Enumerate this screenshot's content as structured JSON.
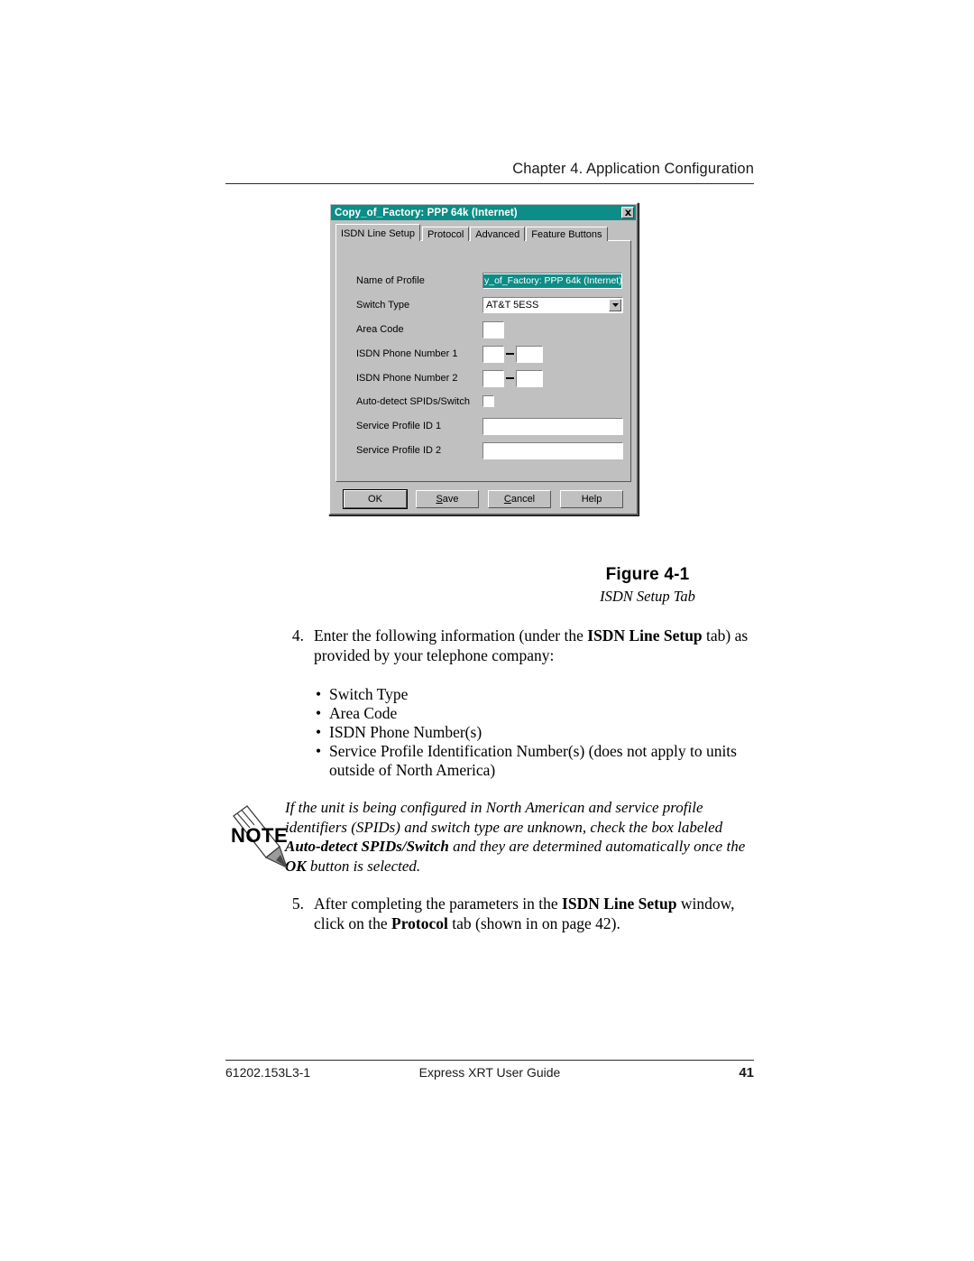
{
  "header": {
    "chapter": "Chapter 4. Application Configuration"
  },
  "dialog": {
    "title": "Copy_of_Factory: PPP 64k (Internet)",
    "close_icon": "close-icon",
    "tabs": [
      {
        "label": "ISDN Line Setup",
        "active": true
      },
      {
        "label": "Protocol",
        "active": false
      },
      {
        "label": "Advanced",
        "active": false
      },
      {
        "label": "Feature Buttons",
        "active": false
      }
    ],
    "fields": {
      "name_of_profile": {
        "label": "Name of Profile",
        "value": "y_of_Factory: PPP 64k (Internet)",
        "selected": true
      },
      "switch_type": {
        "label": "Switch Type",
        "value": "AT&T 5ESS"
      },
      "area_code": {
        "label": "Area Code",
        "value": ""
      },
      "isdn_phone_1": {
        "label": "ISDN Phone Number 1",
        "prefix": "",
        "suffix": "",
        "separator": "–"
      },
      "isdn_phone_2": {
        "label": "ISDN Phone Number 2",
        "prefix": "",
        "suffix": "",
        "separator": "–"
      },
      "auto_detect": {
        "label": "Auto-detect SPIDs/Switch",
        "checked": false
      },
      "spid_1": {
        "label": "Service Profile ID 1",
        "value": ""
      },
      "spid_2": {
        "label": "Service Profile ID 2",
        "value": ""
      }
    },
    "buttons": {
      "ok": "OK",
      "save_pre": "",
      "save_acc": "S",
      "save_post": "ave",
      "cancel_pre": "",
      "cancel_acc": "C",
      "cancel_post": "ancel",
      "help": "Help"
    },
    "colors": {
      "titlebar": "#0c8d87",
      "face": "#c0c0c0",
      "selection": "#0c8d87"
    }
  },
  "figure": {
    "number": "Figure 4-1",
    "title": "ISDN Setup Tab"
  },
  "steps": {
    "step4": {
      "number": "4.",
      "part1": "Enter the following information (under the ",
      "bold1": "ISDN Line Setup",
      "part2": " tab) as provided by your telephone company:"
    },
    "bullets": [
      "Switch Type",
      "Area Code",
      "ISDN Phone Number(s)",
      "Service Profile Identification Number(s) (does not apply to units outside of North America)"
    ],
    "step5": {
      "number": "5.",
      "part1": "After completing the parameters in the ",
      "bold1": "ISDN Line Setup",
      "part2": " window, click on the ",
      "bold2": "Protocol",
      "part3": " tab (shown in  on page 42)."
    }
  },
  "note": {
    "icon_label": "NOTE",
    "part1": "If the unit is being configured in North American and service profile identifiers (SPIDs) and switch type are unknown, check the box labeled ",
    "bold1": "Auto-detect SPIDs/Switch",
    "part2": " and they are determined automatically once the ",
    "bold2": "OK",
    "part3": " button is selected."
  },
  "footer": {
    "doc_number": "61202.153L3-1",
    "guide_title": "Express XRT User Guide",
    "page_number": "41"
  }
}
